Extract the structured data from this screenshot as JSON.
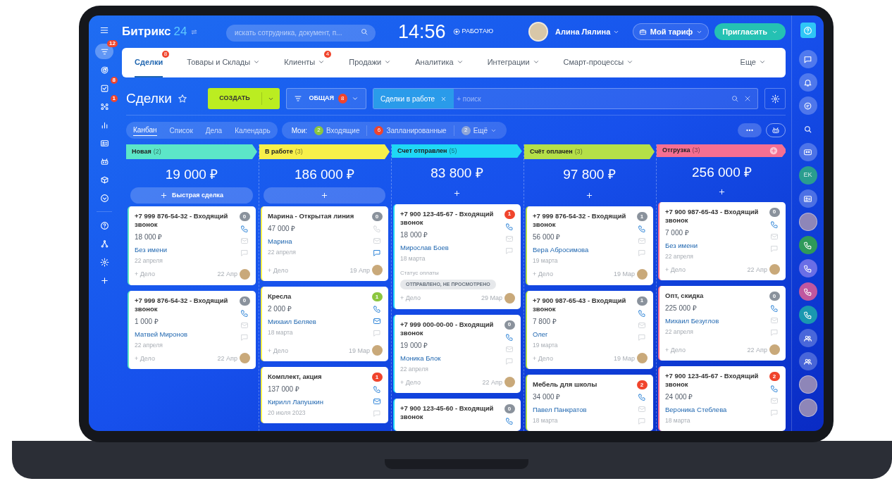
{
  "header": {
    "logo_text": "Битрикс",
    "logo_number": "24",
    "search_placeholder": "искать сотрудника, документ, п...",
    "time": "14:56",
    "work_status": "РАБОТАЮ",
    "user_name": "Алина Лялина",
    "tariff_button": "Мой тариф",
    "invite_button": "Пригласить"
  },
  "left_nav": {
    "main": [
      {
        "badge": "12",
        "selected": true
      },
      {
        "selected": false
      },
      {
        "badge": "8",
        "selected": false
      },
      {
        "badge": "1",
        "selected": false
      },
      {
        "selected": false
      },
      {
        "selected": false
      },
      {
        "selected": false
      },
      {
        "selected": false
      },
      {
        "selected": false
      }
    ],
    "tools": [
      {
        "selected": false
      },
      {
        "selected": false
      },
      {
        "selected": false
      },
      {
        "selected": false
      }
    ]
  },
  "tabs": [
    {
      "label": "Сделки",
      "selected": true,
      "badge": "8",
      "dropdown": false
    },
    {
      "label": "Товары и Склады",
      "selected": false,
      "dropdown": true
    },
    {
      "label": "Клиенты",
      "selected": false,
      "badge": "4",
      "dropdown": true
    },
    {
      "label": "Продажи",
      "selected": false,
      "dropdown": true
    },
    {
      "label": "Аналитика",
      "selected": false,
      "dropdown": true
    },
    {
      "label": "Интеграции",
      "selected": false,
      "dropdown": true
    },
    {
      "label": "Смарт-процессы",
      "selected": false,
      "dropdown": true
    },
    {
      "label": "Еще",
      "selected": false,
      "dropdown": true
    }
  ],
  "toolbar": {
    "title": "Сделки",
    "create_button": "СОЗДАТЬ",
    "funnel_button": "ОБЩАЯ",
    "funnel_badge": "8",
    "filter_chip": "Сделки в работе",
    "search_placeholder": "+ поиск"
  },
  "views": [
    {
      "label": "Канбан",
      "selected": true
    },
    {
      "label": "Список",
      "selected": false
    },
    {
      "label": "Дела",
      "selected": false
    },
    {
      "label": "Календарь",
      "selected": false
    }
  ],
  "counters": {
    "label": "Мои:",
    "items": [
      {
        "count": "2",
        "label": "Входящие",
        "color": "#8cc63f",
        "dropdown": false
      },
      {
        "count": "6",
        "label": "Запланированные",
        "color": "#f0442c",
        "dropdown": false
      },
      {
        "count": "2",
        "label": "Ещё",
        "color": "#8fa6d8",
        "dropdown": true
      }
    ]
  },
  "columns": [
    {
      "name": "Новая",
      "count": "(2)",
      "color": "#5ce6c8",
      "add_stage": false,
      "total": "19 000 ₽",
      "add_label": "Быстрая сделка",
      "cards": [
        {
          "title": "+7 999 876-54-32 - Входящий звонок",
          "amount": "18 000 ₽",
          "contact": "Без имени",
          "date": "22 апреля",
          "badge": "0",
          "color": "#8a929c",
          "phone": true,
          "mail": false,
          "chat": false,
          "task": "+ Дело",
          "deadline": "22 Апр"
        },
        {
          "title": "+7 999 876-54-32 - Входящий звонок",
          "amount": "1 000 ₽",
          "contact": "Матвей Миронов",
          "date": "22 апреля",
          "badge": "0",
          "color": "#8a929c",
          "phone": true,
          "mail": false,
          "chat": false,
          "task": "+ Дело",
          "deadline": "22 Апр"
        }
      ]
    },
    {
      "name": "В работе",
      "count": "(3)",
      "color": "#f7f04a",
      "add_stage": false,
      "total": "186 000 ₽",
      "cards": [
        {
          "title": "Марина - Открытая линия",
          "amount": "47 000 ₽",
          "contact": "Марина",
          "date": "22 апреля",
          "badge": "0",
          "color": "#8a929c",
          "phone": false,
          "mail": false,
          "chat": true,
          "task": "+ Дело",
          "deadline": "19 Апр"
        },
        {
          "title": "Кресла",
          "amount": "2 000 ₽",
          "contact": "Михаил Беляев",
          "date": "18 марта",
          "badge": "1",
          "color": "#8cc63f",
          "phone": true,
          "mail": true,
          "chat": false,
          "task": "+ Дело",
          "deadline": "19 Мар"
        },
        {
          "title": "Комплект, акция",
          "amount": "137 000 ₽",
          "contact": "Кирилл Лапушкин",
          "date": "20 июля 2023",
          "badge": "1",
          "color": "#f0442c",
          "phone": true,
          "mail": true,
          "chat": false
        }
      ]
    },
    {
      "name": "Счет отправлен",
      "count": "(5)",
      "color": "#1fd8f5",
      "add_stage": false,
      "total": "83 800 ₽",
      "cards": [
        {
          "title": "+7 900 123-45-67 - Входящий звонок",
          "amount": "18 000 ₽",
          "contact": "Мирослав Боев",
          "date": "18 марта",
          "payment_label": "Статус оплаты",
          "payment_status": "ОТПРАВЛЕНО, НЕ ПРОСМОТРЕНО",
          "badge": "1",
          "color": "#f0442c",
          "phone": true,
          "mail": false,
          "chat": false,
          "task": "+ Дело",
          "deadline": "29 Мар"
        },
        {
          "title": "+7 999 000-00-00 - Входящий звонок",
          "amount": "19 000 ₽",
          "contact": "Моника Блок",
          "date": "22 апреля",
          "badge": "0",
          "color": "#8a929c",
          "phone": true,
          "mail": false,
          "chat": false,
          "task": "+ Дело",
          "deadline": "22 Апр"
        },
        {
          "title": "+7 900 123-45-60 - Входящий звонок",
          "badge": "0",
          "color": "#8a929c",
          "phone": true
        }
      ]
    },
    {
      "name": "Счёт оплачен",
      "count": "(3)",
      "color": "#b5e048",
      "add_stage": false,
      "total": "97 800 ₽",
      "cards": [
        {
          "title": "+7 999 876-54-32 - Входящий звонок",
          "amount": "56 000 ₽",
          "contact": "Вера Абросимова",
          "date": "19 марта",
          "badge": "1",
          "color": "#8a929c",
          "phone": true,
          "mail": false,
          "chat": false,
          "task": "+ Дело",
          "deadline": "19 Мар"
        },
        {
          "title": "+7 900 987-65-43 - Входящий звонок",
          "amount": "7 800 ₽",
          "contact": "Олег",
          "date": "19 марта",
          "badge": "1",
          "color": "#8a929c",
          "phone": true,
          "mail": false,
          "chat": false,
          "task": "+ Дело",
          "deadline": "19 Мар"
        },
        {
          "title": "Мебель для школы",
          "amount": "34 000 ₽",
          "contact": "Павел Панкратов",
          "date": "18 марта",
          "badge": "2",
          "color": "#f0442c",
          "phone": true,
          "mail": false,
          "chat": false
        }
      ]
    },
    {
      "name": "Отгрузка",
      "count": "(3)",
      "color": "#f56f92",
      "add_stage": true,
      "total": "256 000 ₽",
      "cards": [
        {
          "title": "+7 900 987-65-43 - Входящий звонок",
          "amount": "7 000 ₽",
          "contact": "Без имени",
          "date": "22 апреля",
          "badge": "0",
          "color": "#8a929c",
          "phone": true,
          "mail": false,
          "chat": false,
          "task": "+ Дело",
          "deadline": "22 Апр"
        },
        {
          "title": "Опт, скидка",
          "amount": "225 000 ₽",
          "contact": "Михаил Безуглов",
          "date": "22 апреля",
          "badge": "0",
          "color": "#8a929c",
          "phone": true,
          "mail": false,
          "chat": false,
          "task": "+ Дело",
          "deadline": "22 Апр"
        },
        {
          "title": "+7 900 123-45-67 - Входящий звонок",
          "amount": "24 000 ₽",
          "contact": "Вероника Стеблева",
          "date": "18 марта",
          "badge": "2",
          "color": "#f0442c",
          "phone": true,
          "mail": false,
          "chat": false
        }
      ]
    }
  ],
  "right_rail": [
    {
      "kind": "help"
    },
    {
      "kind": "chat"
    },
    {
      "kind": "bell"
    },
    {
      "kind": "dialog"
    },
    {
      "kind": "search"
    },
    {
      "kind": "group"
    },
    {
      "kind": "initials",
      "text": "EK",
      "color": "#2a9d8f"
    },
    {
      "kind": "card"
    },
    {
      "kind": "avatar"
    },
    {
      "kind": "phone",
      "color": "#2f9a5a"
    },
    {
      "kind": "phone",
      "color": "#6a6ee6"
    },
    {
      "kind": "phone",
      "color": "#c0579f"
    },
    {
      "kind": "phone",
      "color": "#1a98b0"
    },
    {
      "kind": "people"
    },
    {
      "kind": "people"
    },
    {
      "kind": "avatar"
    },
    {
      "kind": "avatar"
    }
  ]
}
